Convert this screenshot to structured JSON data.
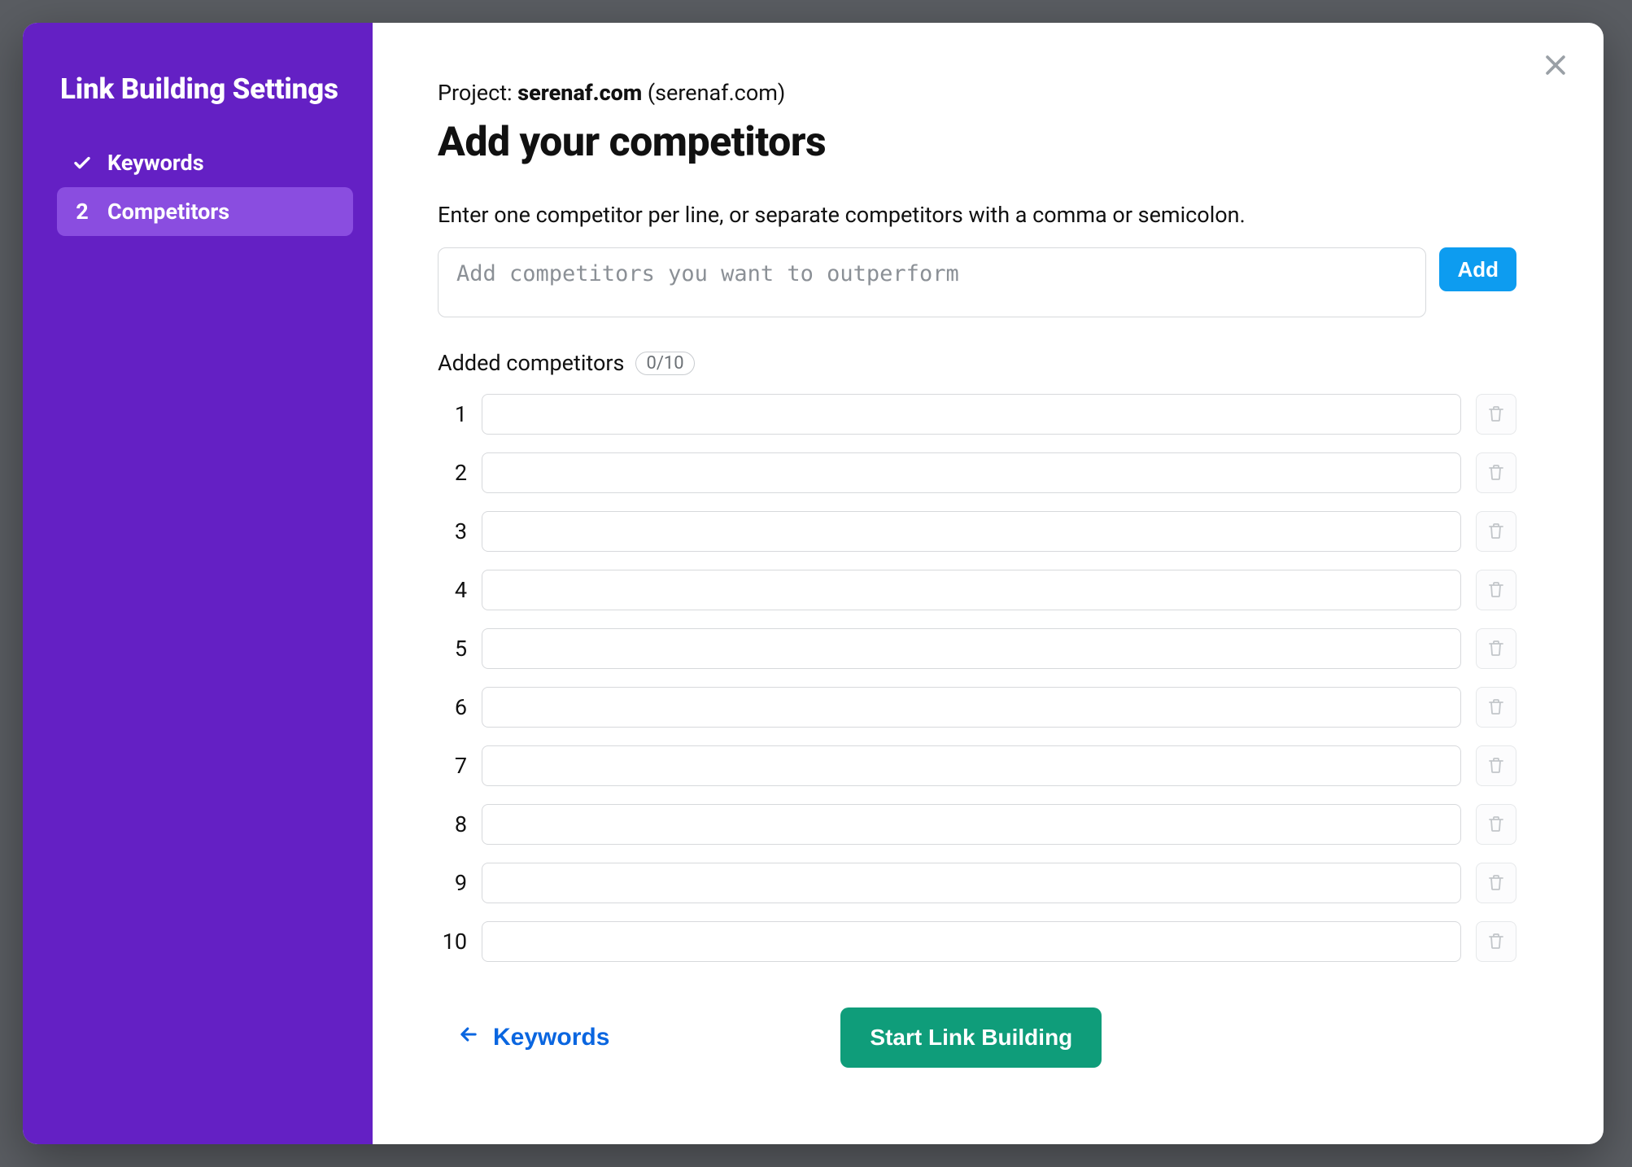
{
  "sidebar": {
    "title": "Link Building Settings",
    "steps": [
      {
        "id": "keywords",
        "label": "Keywords",
        "completed": true,
        "active": false
      },
      {
        "id": "competitors",
        "label": "Competitors",
        "completed": false,
        "active": true,
        "number": "2"
      }
    ]
  },
  "project": {
    "label": "Project: ",
    "domain": "serenaf.com",
    "paren": " (serenaf.com)"
  },
  "page": {
    "title": "Add your competitors",
    "instructions": "Enter one competitor per line, or separate competitors with a comma or semicolon."
  },
  "entry": {
    "placeholder": "Add competitors you want to outperform",
    "value": "",
    "add_label": "Add"
  },
  "added": {
    "label": "Added competitors",
    "count_text": "0/10",
    "rows": [
      {
        "n": "1",
        "value": ""
      },
      {
        "n": "2",
        "value": ""
      },
      {
        "n": "3",
        "value": ""
      },
      {
        "n": "4",
        "value": ""
      },
      {
        "n": "5",
        "value": ""
      },
      {
        "n": "6",
        "value": ""
      },
      {
        "n": "7",
        "value": ""
      },
      {
        "n": "8",
        "value": ""
      },
      {
        "n": "9",
        "value": ""
      },
      {
        "n": "10",
        "value": ""
      }
    ]
  },
  "footer": {
    "back_label": "Keywords",
    "primary_label": "Start Link Building"
  }
}
